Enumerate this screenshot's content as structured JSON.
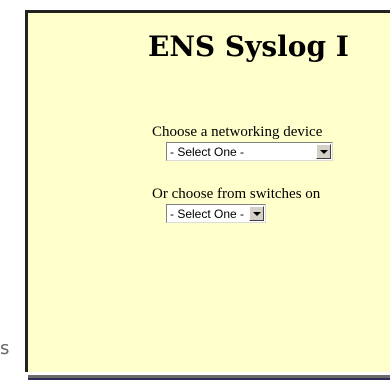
{
  "page": {
    "title": "ENS Syslog I",
    "edge_text": "s"
  },
  "device_selector": {
    "label": "Choose a networking device",
    "selected_value": "- Select One -"
  },
  "switch_selector": {
    "label": "Or choose from switches on",
    "selected_value": "- Select One -"
  },
  "colors": {
    "panel_background": "#ffffcc",
    "border": "#222222",
    "control_face": "#d4d0c8"
  },
  "icons": {
    "dropdown_arrow": "chevron-down-icon"
  }
}
